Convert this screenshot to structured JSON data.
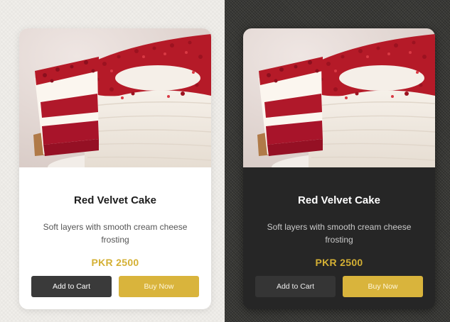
{
  "colors": {
    "accent_gold": "#d9b43c",
    "price_gold": "#d4b034",
    "light_card_bg": "#ffffff",
    "dark_card_bg": "#262626",
    "cart_button_bg": "#3a3a3a"
  },
  "cards": [
    {
      "theme": "light",
      "image_alt": "red-velvet-cake-image",
      "title": "Red Velvet Cake",
      "description": "Soft layers with smooth cream cheese frosting",
      "price": "PKR 2500",
      "add_to_cart_label": "Add to Cart",
      "buy_now_label": "Buy Now"
    },
    {
      "theme": "dark",
      "image_alt": "red-velvet-cake-image",
      "title": "Red Velvet Cake",
      "description": "Soft layers with smooth cream cheese frosting",
      "price": "PKR 2500",
      "add_to_cart_label": "Add to Cart",
      "buy_now_label": "Buy Now"
    }
  ]
}
